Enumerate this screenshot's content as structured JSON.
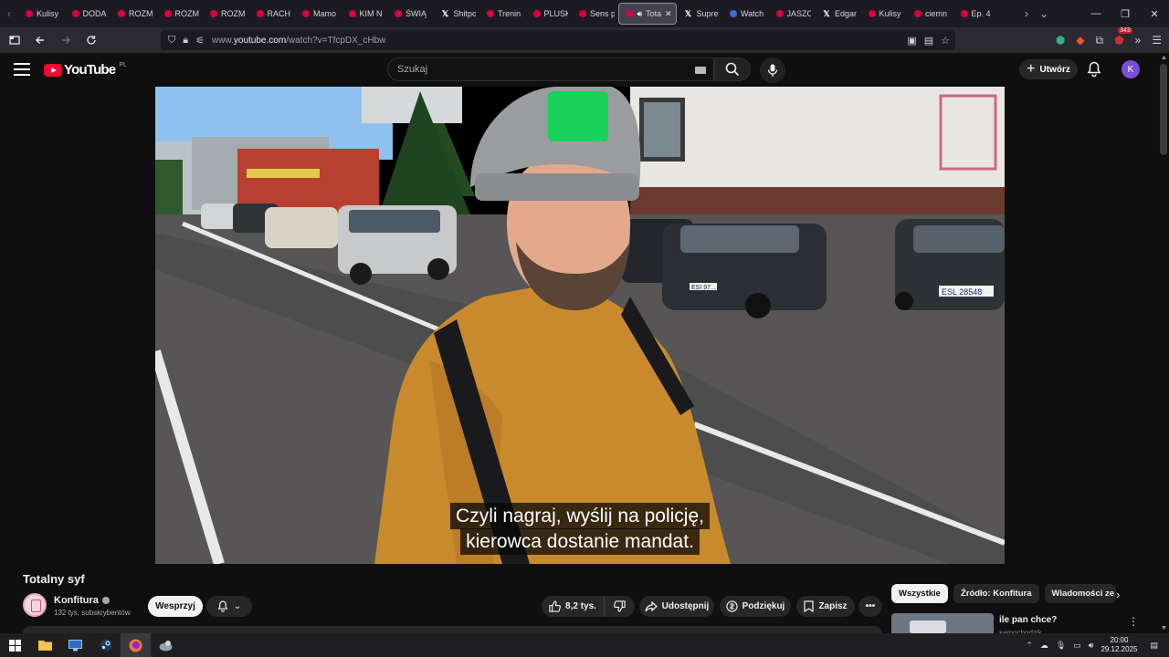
{
  "browser": {
    "tabs": [
      {
        "title": "Kulisy",
        "icon": "red-dot"
      },
      {
        "title": "DODA",
        "icon": "red-dot"
      },
      {
        "title": "ROZM",
        "icon": "red-dot"
      },
      {
        "title": "ROZM",
        "icon": "red-dot"
      },
      {
        "title": "ROZM",
        "icon": "red-dot"
      },
      {
        "title": "RACH",
        "icon": "red-dot"
      },
      {
        "title": "Mamo",
        "icon": "red-dot"
      },
      {
        "title": "KIM N",
        "icon": "red-dot"
      },
      {
        "title": "ŚWIĄ",
        "icon": "red-dot"
      },
      {
        "title": "Shitpo",
        "icon": "x"
      },
      {
        "title": "Trenin",
        "icon": "red-dot"
      },
      {
        "title": "PLUSK",
        "icon": "red-dot"
      },
      {
        "title": "Sens p",
        "icon": "red-dot"
      },
      {
        "title": "Tota",
        "icon": "red-dot",
        "active": true
      },
      {
        "title": "Supre",
        "icon": "x"
      },
      {
        "title": "Watch",
        "icon": "globe"
      },
      {
        "title": "JASZC",
        "icon": "red-dot"
      },
      {
        "title": "Edgar",
        "icon": "x"
      },
      {
        "title": "Kulisy",
        "icon": "red-dot"
      },
      {
        "title": "ciemn",
        "icon": "red-dot"
      },
      {
        "title": "Ep. 4",
        "icon": "red-dot"
      }
    ],
    "url_prefix": "www.",
    "url_domain": "youtube.com",
    "url_path": "/watch?v=TfcpDX_cHbw",
    "extension_badge": "343"
  },
  "youtube": {
    "logo_text": "YouTube",
    "region": "PL",
    "search_placeholder": "Szukaj",
    "create_label": "Utwórz",
    "avatar_letter": "K"
  },
  "video": {
    "subtitle_line1": "Czyli nagraj, wyślij na policję,",
    "subtitle_line2": "kierowca dostanie mandat.",
    "plate_left": "ESI 97...",
    "plate_right": "ESL 28548"
  },
  "watch": {
    "title": "Totalny syf",
    "channel": "Konfitura",
    "subscribers": "132 tys. subskrybentów",
    "support_label": "Wesprzyj",
    "likes": "8,2 tys.",
    "share_label": "Udostępnij",
    "thanks_label": "Podziękuj",
    "save_label": "Zapisz"
  },
  "sidebar": {
    "chips": [
      "Wszystkie",
      "Źródło: Konfitura",
      "Wiadomości ze"
    ],
    "rec_title": "ile pan chce?",
    "rec_channel": "samochodzik"
  },
  "taskbar": {
    "time": "20:00",
    "date": "29.12.2025"
  },
  "colors": {
    "youtube_red": "#ff0033",
    "avatar_purple": "#7b4fd6",
    "page_bg": "#0f0f0f"
  }
}
